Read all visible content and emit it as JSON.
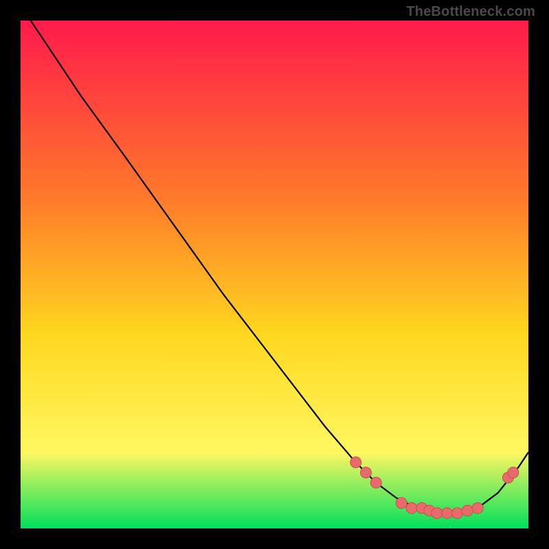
{
  "watermark": "TheBottleneck.com",
  "colors": {
    "frame": "#000000",
    "gradient_top": "#ff1a4b",
    "gradient_mid1": "#ff7a2a",
    "gradient_mid2": "#ffd81f",
    "gradient_mid3": "#fff760",
    "gradient_bottom": "#00e05a",
    "curve": "#000000",
    "dot_fill": "#e96a6a",
    "dot_stroke": "#c94f4f"
  },
  "chart_data": {
    "type": "line",
    "title": "",
    "xlabel": "",
    "ylabel": "",
    "xlim": [
      0,
      100
    ],
    "ylim": [
      0,
      100
    ],
    "grid": false,
    "legend": false,
    "series": [
      {
        "name": "curve",
        "x": [
          2,
          6,
          12,
          20,
          30,
          40,
          50,
          60,
          66,
          70,
          74,
          78,
          82,
          86,
          90,
          94,
          98,
          100
        ],
        "y": [
          100,
          94,
          85,
          74,
          60,
          46,
          33,
          20,
          13,
          9,
          6,
          4,
          3,
          3,
          4,
          7,
          12,
          15
        ]
      }
    ],
    "points": [
      {
        "name": "p1",
        "x": 66,
        "y": 13
      },
      {
        "name": "p2",
        "x": 68,
        "y": 11
      },
      {
        "name": "p3",
        "x": 70,
        "y": 9
      },
      {
        "name": "p4",
        "x": 75,
        "y": 5
      },
      {
        "name": "p5",
        "x": 77,
        "y": 4
      },
      {
        "name": "p6",
        "x": 79,
        "y": 4
      },
      {
        "name": "p7",
        "x": 80.5,
        "y": 3.5
      },
      {
        "name": "p8",
        "x": 82,
        "y": 3
      },
      {
        "name": "p9",
        "x": 84,
        "y": 3
      },
      {
        "name": "p10",
        "x": 86,
        "y": 3
      },
      {
        "name": "p11",
        "x": 88,
        "y": 3.5
      },
      {
        "name": "p12",
        "x": 90,
        "y": 4
      },
      {
        "name": "p13",
        "x": 96,
        "y": 10
      },
      {
        "name": "p14",
        "x": 97,
        "y": 11
      }
    ]
  }
}
